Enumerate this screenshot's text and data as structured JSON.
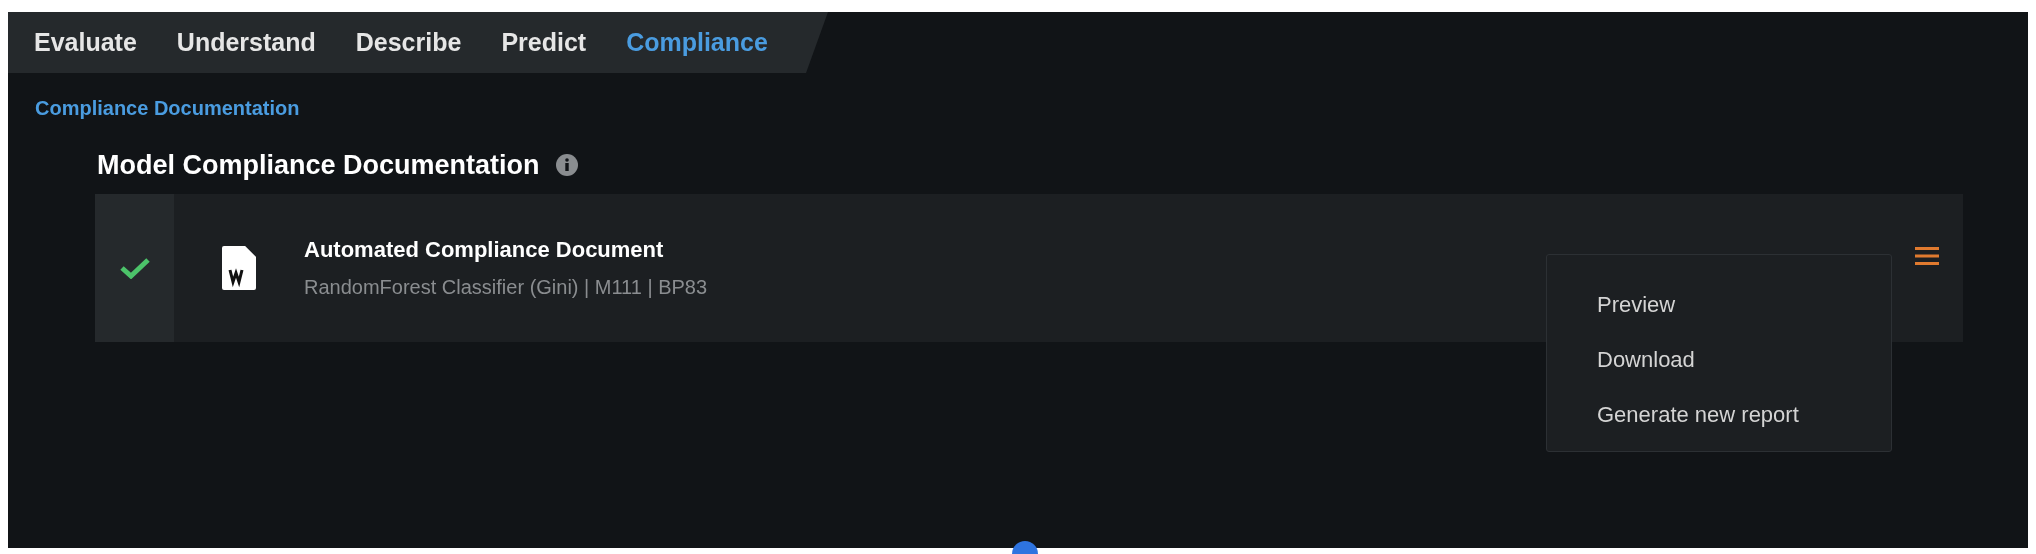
{
  "tabs": [
    {
      "label": "Evaluate",
      "selected": false
    },
    {
      "label": "Understand",
      "selected": false
    },
    {
      "label": "Describe",
      "selected": false
    },
    {
      "label": "Predict",
      "selected": false
    },
    {
      "label": "Compliance",
      "selected": true
    }
  ],
  "breadcrumb": "Compliance Documentation",
  "section": {
    "title": "Model Compliance Documentation"
  },
  "document": {
    "complete": true,
    "title": "Automated Compliance Document",
    "subtitle": "RandomForest Classifier (Gini) | M111 | BP83"
  },
  "menu": {
    "expanded": true,
    "items": [
      "Preview",
      "Download",
      "Generate new report"
    ]
  }
}
